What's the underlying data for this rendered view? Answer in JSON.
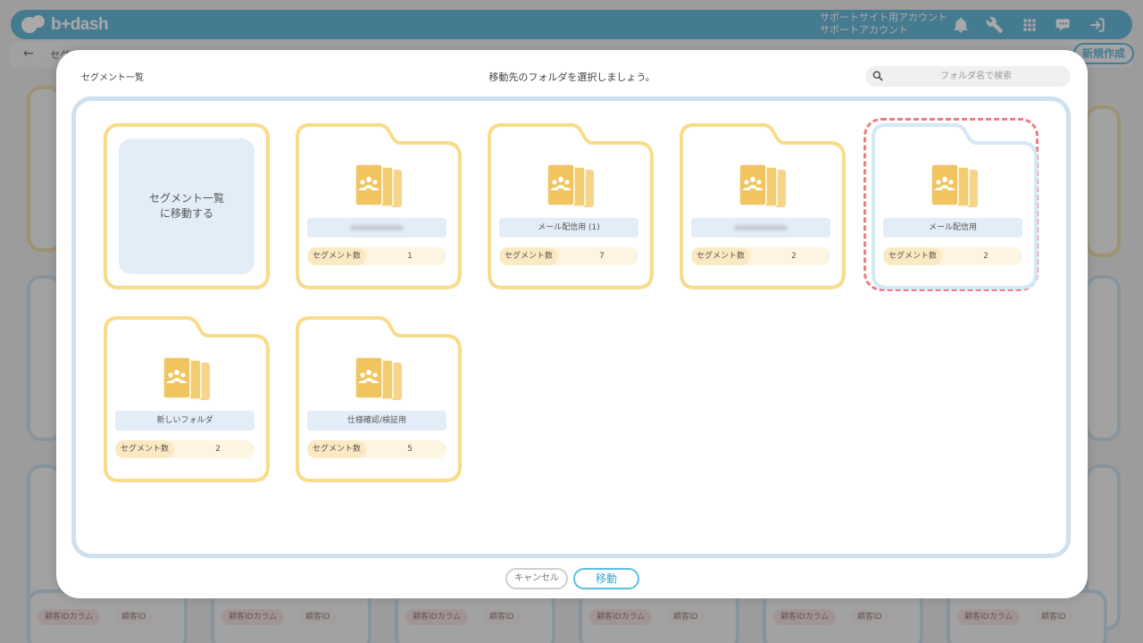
{
  "app": {
    "logo_text": "b+dash",
    "account_line1": "サポートサイト用アカウント",
    "account_line2": "サポートアカウント"
  },
  "page": {
    "back_icon": "arrow-left-icon",
    "title": "セグ",
    "new_button": "新規作成",
    "bg_key_label": "顧客IDカラム",
    "bg_value_label": "顧客ID"
  },
  "modal": {
    "breadcrumb": "セグメント一覧",
    "title": "移動先のフォルダを選択しましょう。",
    "search": {
      "placeholder": "フォルダ名で検索",
      "value": ""
    },
    "goto_card": {
      "label": "セグメント一覧\nに移動する"
    },
    "count_label": "セグメント数",
    "folders": [
      {
        "name": "",
        "redacted": true,
        "count": "1",
        "selected": false
      },
      {
        "name": "メール配信用 (1)",
        "redacted": false,
        "count": "7",
        "selected": false
      },
      {
        "name": "",
        "redacted": true,
        "count": "2",
        "selected": false
      },
      {
        "name": "メール配信用",
        "redacted": false,
        "count": "2",
        "selected": true
      },
      {
        "name": "新しいフォルダ",
        "redacted": false,
        "count": "2",
        "selected": false
      },
      {
        "name": "仕様確認/検証用",
        "redacted": false,
        "count": "5",
        "selected": false
      }
    ],
    "cancel_button": "キャンセル",
    "move_button": "移動"
  },
  "colors": {
    "brand": "#59b2d6",
    "folder_border": "#f9dc8a",
    "selected_dash": "#ef7c85",
    "name_bar": "#e2edf7"
  }
}
